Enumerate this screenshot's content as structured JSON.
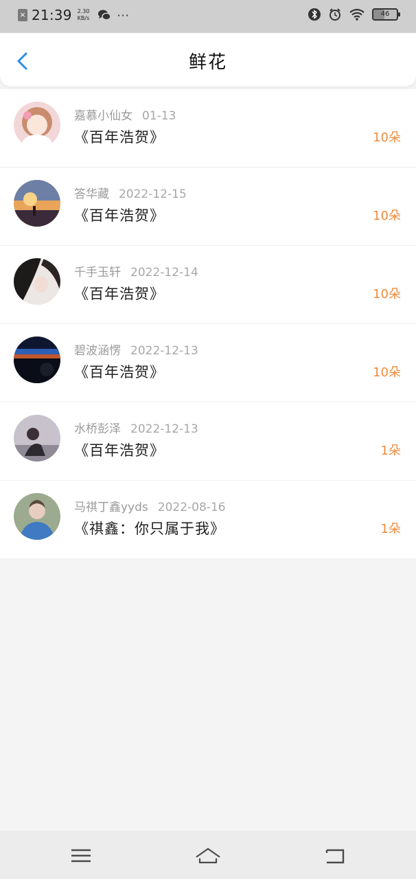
{
  "status_bar": {
    "time": "21:39",
    "net_speed_value": "2.30",
    "net_speed_unit": "KB/s",
    "more": "···",
    "battery_level": "46",
    "icons": [
      "close-notification-icon",
      "wechat-icon",
      "bluetooth-icon",
      "alarm-icon",
      "wifi-icon",
      "battery-icon"
    ]
  },
  "header": {
    "title": "鲜花",
    "back_icon": "chevron-left-icon",
    "accent": "#2b8de8"
  },
  "records": [
    {
      "user": "嘉慕小仙女",
      "date": "01-13",
      "work": "《百年浩贺》",
      "flowers": "10朵"
    },
    {
      "user": "答华藏",
      "date": "2022-12-15",
      "work": "《百年浩贺》",
      "flowers": "10朵"
    },
    {
      "user": "千手玉轩",
      "date": "2022-12-14",
      "work": "《百年浩贺》",
      "flowers": "10朵"
    },
    {
      "user": "碧波涵愣",
      "date": "2022-12-13",
      "work": "《百年浩贺》",
      "flowers": "10朵"
    },
    {
      "user": "水桥彭泽",
      "date": "2022-12-13",
      "work": "《百年浩贺》",
      "flowers": "1朵"
    },
    {
      "user": "马祺丁鑫yyds",
      "date": "2022-08-16",
      "work": "《祺鑫：你只属于我》",
      "flowers": "1朵"
    }
  ],
  "colors": {
    "flower_count": "#ef8a3a",
    "page_background": "#f5f4f5"
  },
  "nav_bar": {
    "icons": [
      "menu-icon",
      "home-icon",
      "back-icon"
    ]
  }
}
